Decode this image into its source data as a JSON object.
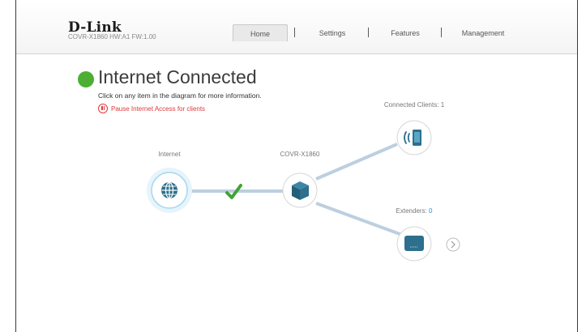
{
  "header": {
    "logo": "D-Link",
    "model_info": "COVR-X1860 HW:A1 FW:1.00",
    "tabs": [
      {
        "label": "Home",
        "active": true
      },
      {
        "label": "Settings",
        "active": false
      },
      {
        "label": "Features",
        "active": false
      },
      {
        "label": "Management",
        "active": false
      }
    ]
  },
  "status": {
    "title": "Internet Connected",
    "color": "#4caf33",
    "instruction": "Click on any item in the diagram for more information.",
    "pause_link": "Pause Internet Access for clients",
    "pause_color": "#e0383b"
  },
  "diagram": {
    "internet": {
      "label": "Internet",
      "icon": "globe-icon"
    },
    "router": {
      "label": "COVR-X1860",
      "icon": "router-cube-icon"
    },
    "connection_status_icon": "checkmark-icon",
    "clients": {
      "label": "Connected Clients:",
      "count": "1",
      "icon": "wireless-phone-icon"
    },
    "extenders": {
      "label": "Extenders:",
      "count": "0",
      "icon": "extender-icon"
    },
    "more_icon": "chevron-right-icon",
    "accent_color": "#2d6f8c",
    "link_color": "#bccfe0"
  }
}
